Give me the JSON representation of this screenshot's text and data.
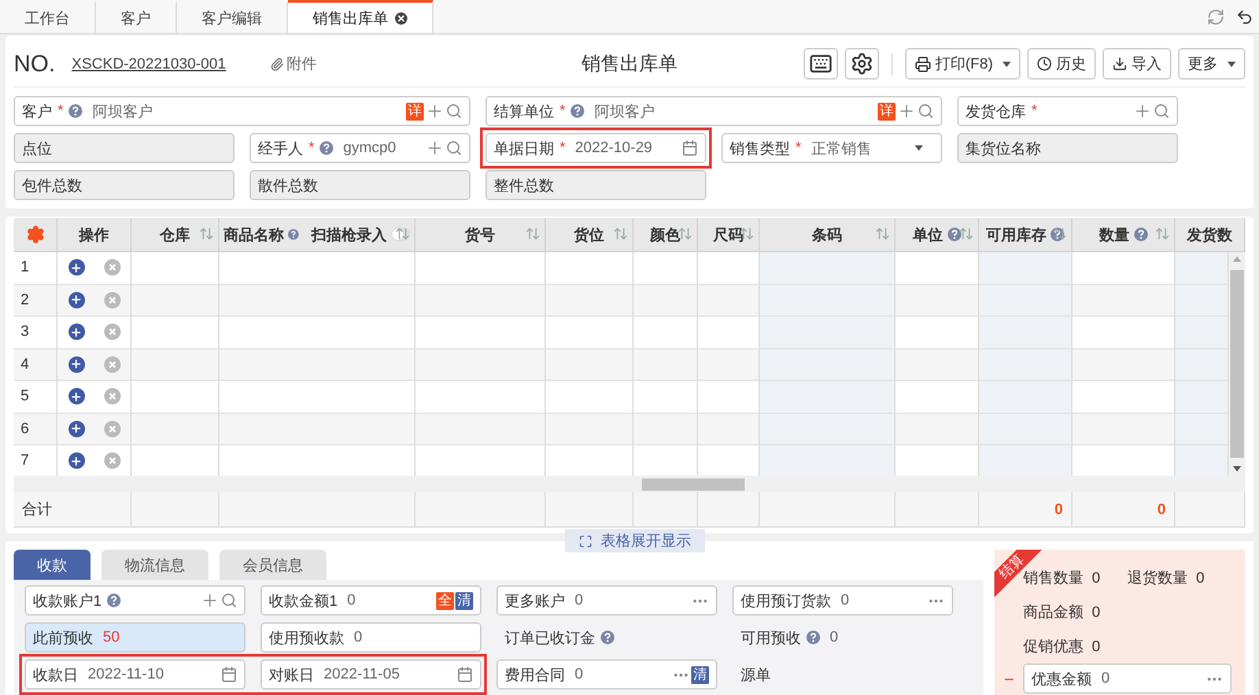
{
  "tabs": [
    {
      "label": "工作台",
      "selected": false,
      "closable": false
    },
    {
      "label": "客户",
      "selected": false,
      "closable": false
    },
    {
      "label": "客户编辑",
      "selected": false,
      "closable": false
    },
    {
      "label": "销售出库单",
      "selected": true,
      "closable": true
    }
  ],
  "document": {
    "no_label": "NO.",
    "number": "XSCKD-20221030-001",
    "attach": "附件",
    "title": "销售出库单"
  },
  "toolbar": [
    {
      "kind": "icon"
    },
    {
      "kind": "icon"
    },
    {
      "kind": "menu",
      "label": "打印(F8)"
    },
    {
      "kind": "button",
      "label": "历史"
    },
    {
      "kind": "button",
      "label": "导入"
    },
    {
      "kind": "menu",
      "label": "更多"
    }
  ],
  "header_fields": [
    {
      "kind": "input",
      "wide": true,
      "label": "客户",
      "required_mark": "*",
      "help": true,
      "value": "阿坝客户",
      "actions": [
        {
          "kind": "badge",
          "text": "详",
          "color": "#f4511e"
        },
        {
          "kind": "add"
        },
        {
          "kind": "search"
        }
      ]
    },
    {
      "kind": "input",
      "wide": true,
      "label": "结算单位",
      "required_mark": "*",
      "help": true,
      "value": "阿坝客户",
      "actions": [
        {
          "kind": "badge",
          "text": "详",
          "color": "#f4511e"
        },
        {
          "kind": "add"
        },
        {
          "kind": "search"
        }
      ]
    },
    {
      "kind": "input",
      "label": "发货仓库",
      "required_mark": "*",
      "actions": [
        {
          "kind": "add"
        },
        {
          "kind": "search"
        }
      ]
    },
    {
      "kind": "readonly",
      "label": "点位"
    },
    {
      "kind": "input",
      "label": "经手人",
      "required_mark": "*",
      "help": true,
      "value": "gymcp0",
      "actions": [
        {
          "kind": "add"
        },
        {
          "kind": "search"
        }
      ]
    },
    {
      "kind": "input",
      "label": "单据日期",
      "required_mark": "*",
      "value": "2022-10-29",
      "highlighted": true,
      "actions": [
        {
          "kind": "calendar"
        }
      ]
    },
    {
      "kind": "input",
      "label": "销售类型",
      "required_mark": "*",
      "value": "正常销售",
      "actions": [
        {
          "kind": "dropdown"
        }
      ]
    },
    {
      "kind": "readonly",
      "label": "集货位名称"
    },
    {
      "kind": "readonly",
      "label": "包件总数"
    },
    {
      "kind": "readonly",
      "label": "散件总数"
    },
    {
      "kind": "readonly",
      "label": "整件总数"
    }
  ],
  "table": {
    "ops_label": "操作",
    "total_label": "合计",
    "columns": [
      {
        "label": "仓库",
        "sortable": true
      },
      {
        "label": "商品名称",
        "help": true,
        "toggle_label": "扫描枪录入",
        "toggle_on": false,
        "sortable": true
      },
      {
        "label": "货号",
        "sortable": true
      },
      {
        "label": "货位",
        "sortable": true
      },
      {
        "label": "颜色",
        "sortable": true
      },
      {
        "label": "尺码",
        "sortable": true
      },
      {
        "label": "条码",
        "sortable": true,
        "shaded": true
      },
      {
        "label": "单位",
        "help": true,
        "sortable": true
      },
      {
        "label": "可用库存",
        "help": true,
        "sortable": true,
        "shaded": true,
        "total": "0"
      },
      {
        "label": "数量",
        "help": true,
        "sortable": true,
        "total": "0"
      },
      {
        "label": "发货数",
        "shaded": true
      }
    ],
    "rows": [
      "1",
      "2",
      "3",
      "4",
      "5",
      "6",
      "7"
    ],
    "expand_label": "表格展开显示"
  },
  "bottom_tabs": [
    {
      "label": "收款",
      "selected": true
    },
    {
      "label": "物流信息",
      "selected": false
    },
    {
      "label": "会员信息",
      "selected": false
    }
  ],
  "payment_fields": [
    {
      "kind": "input",
      "label": "收款账户1",
      "help": true,
      "actions": [
        {
          "kind": "add"
        },
        {
          "kind": "search"
        }
      ]
    },
    {
      "kind": "input",
      "label": "收款金额1",
      "value": "0",
      "actions": [
        {
          "kind": "badge",
          "text": "全",
          "color": "#f4511e"
        },
        {
          "kind": "badge",
          "text": "清",
          "color": "#4a64a8"
        }
      ]
    },
    {
      "kind": "input",
      "label": "更多账户",
      "value": "0",
      "actions": [
        {
          "kind": "more"
        }
      ]
    },
    {
      "kind": "input",
      "label": "使用预订货款",
      "value": "0",
      "actions": [
        {
          "kind": "more"
        }
      ]
    },
    {
      "kind": "info",
      "label": "此前预收",
      "value": "50"
    },
    {
      "kind": "input",
      "label": "使用预收款",
      "value": "0"
    },
    {
      "kind": "text",
      "label": "订单已收订金",
      "help": true
    },
    {
      "kind": "text",
      "label": "可用预收",
      "help": true,
      "value": "0"
    },
    {
      "kind": "input",
      "label": "收款日",
      "value": "2022-11-10",
      "highlighted": true,
      "actions": [
        {
          "kind": "calendar"
        }
      ]
    },
    {
      "kind": "input",
      "label": "对账日",
      "value": "2022-11-05",
      "highlighted": true,
      "actions": [
        {
          "kind": "calendar"
        }
      ]
    },
    {
      "kind": "input",
      "label": "费用合同",
      "value": "0",
      "actions": [
        {
          "kind": "more"
        },
        {
          "kind": "badge",
          "text": "清",
          "color": "#4a64a8"
        }
      ]
    },
    {
      "kind": "text",
      "label": "源单"
    }
  ],
  "summary": {
    "ribbon": "结算",
    "rows": [
      [
        {
          "label": "销售数量",
          "value": "0"
        },
        {
          "label": "退货数量",
          "value": "0"
        }
      ],
      [
        {
          "label": "商品金额",
          "value": "0"
        }
      ],
      [
        {
          "label": "促销优惠",
          "value": "0"
        }
      ]
    ],
    "fields": [
      {
        "sign": "−",
        "label": "优惠金额",
        "value": "0",
        "actions": [
          {
            "kind": "more"
          }
        ]
      }
    ]
  }
}
